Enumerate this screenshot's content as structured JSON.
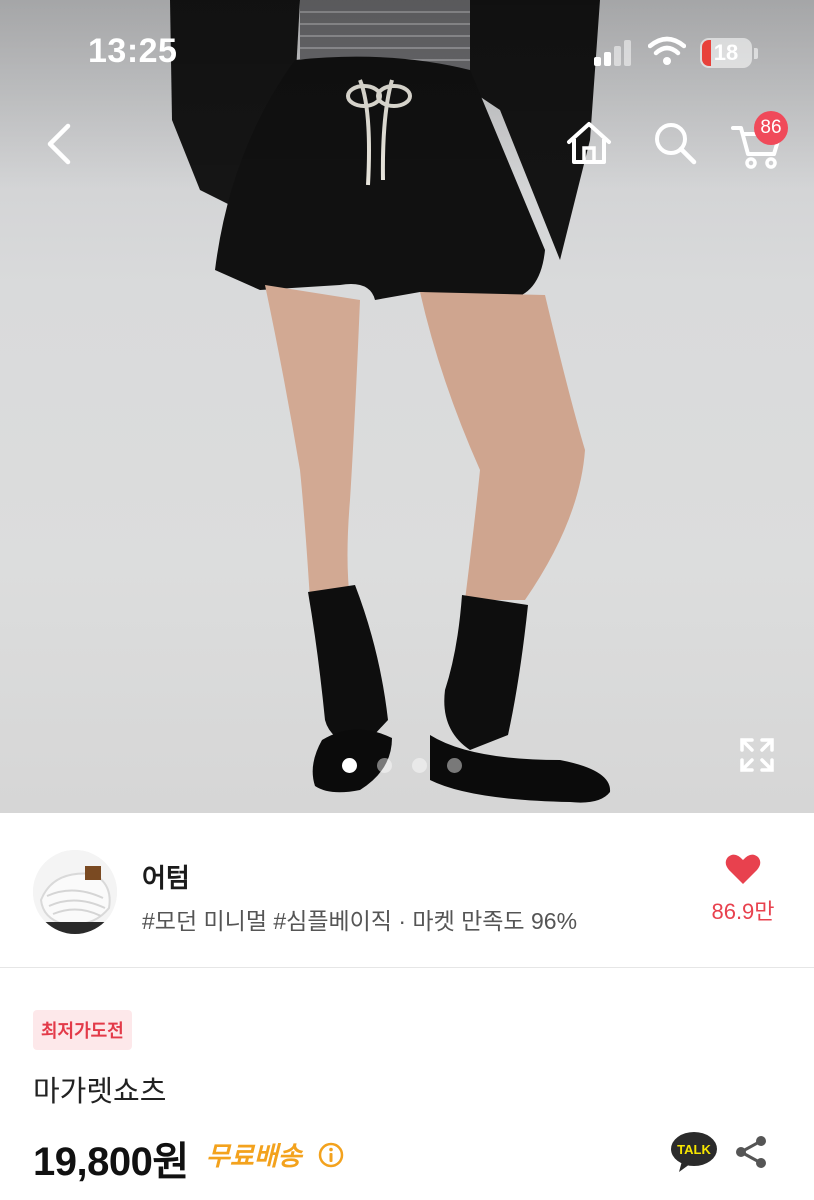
{
  "status_bar": {
    "time": "13:25",
    "battery": "18"
  },
  "header": {
    "back_icon": "chevron-left-icon",
    "home_icon": "home-icon",
    "search_icon": "search-icon",
    "cart_icon": "cart-icon",
    "cart_count": "86"
  },
  "gallery": {
    "image_count": 4,
    "active_index": 0,
    "expand_icon": "expand-icon"
  },
  "seller": {
    "name": "어텀",
    "tags": "#모던 미니멀 #심플베이직 · 마켓 만족도 96%",
    "like_count": "86.9만",
    "like_icon": "heart-icon"
  },
  "product": {
    "badge": "최저가도전",
    "name": "마가렛쇼츠",
    "price": "19,800원",
    "shipping": "무료배송",
    "talk_label": "TALK",
    "share_icon": "share-icon"
  },
  "colors": {
    "accent": "#e8414e",
    "shipping": "#f3a21d",
    "badge_bg": "#fde8ea"
  }
}
